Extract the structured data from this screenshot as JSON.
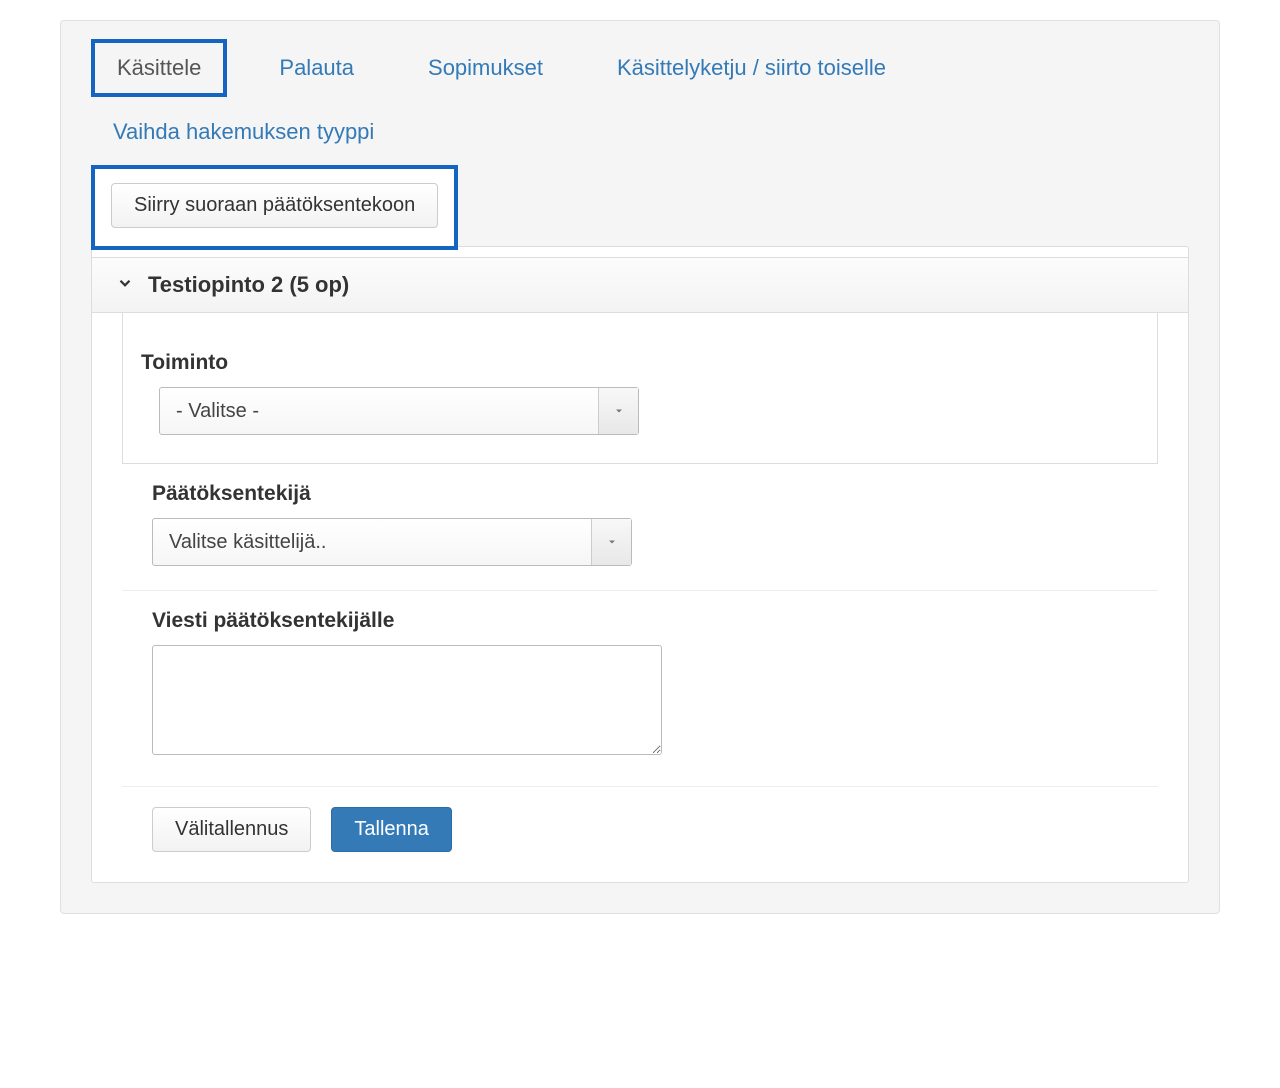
{
  "tabs": {
    "process": "Käsittele",
    "return": "Palauta",
    "contracts": "Sopimukset",
    "chain": "Käsittelyketju / siirto toiselle",
    "change_type": "Vaihda hakemuksen tyyppi"
  },
  "actions": {
    "go_direct": "Siirry suoraan päätöksentekoon",
    "save_draft": "Välitallennus",
    "save": "Tallenna"
  },
  "accordion": {
    "title": "Testiopinto 2 (5 op)"
  },
  "form": {
    "action_label": "Toiminto",
    "action_selected": "- Valitse -",
    "decider_label": "Päätöksentekijä",
    "decider_selected": "Valitse käsittelijä..",
    "message_label": "Viesti päätöksentekijälle",
    "message_value": ""
  }
}
